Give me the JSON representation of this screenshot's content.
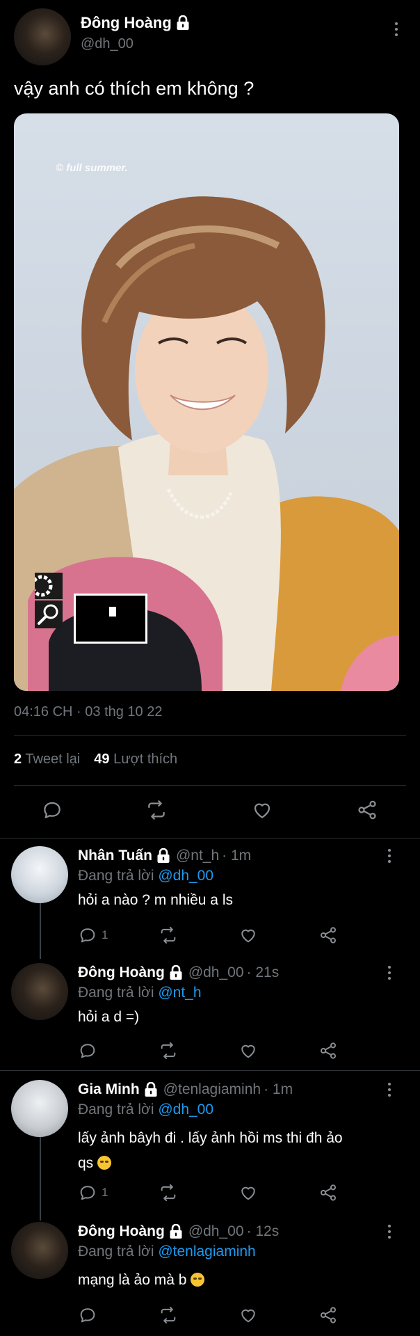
{
  "tweet": {
    "author_name": "Đông Hoàng",
    "author_handle": "@dh_00",
    "text": "vậy anh có thích em không ?",
    "watermark": "© full summer.",
    "timestamp": "04:16 CH · 03 thg 10 22",
    "retweet_count": "2",
    "retweet_label": "Tweet lại",
    "like_count": "49",
    "like_label": "Lượt thích"
  },
  "replies": [
    {
      "name": "Nhân Tuấn",
      "handle": "@nt_h",
      "time": "· 1m",
      "replying_label": "Đang trả lời",
      "replying_to": "@dh_00",
      "text": "hỏi a nào ? m nhiều a ls",
      "reply_count": "1"
    },
    {
      "name": "Đông Hoàng",
      "handle": "@dh_00",
      "time": "· 21s",
      "replying_label": "Đang trả lời",
      "replying_to": "@nt_h",
      "text": "hỏi a d =)"
    },
    {
      "name": "Gia Minh",
      "handle": "@tenlagiaminh",
      "time": "· 1m",
      "replying_label": "Đang trả lời",
      "replying_to": "@dh_00",
      "text_line1": "lấy ảnh bâyh đi . lấy ảnh hồi ms thi đh ảo",
      "text_line2": "qs",
      "reply_count": "1"
    },
    {
      "name": "Đông Hoàng",
      "handle": "@dh_00",
      "time": "· 12s",
      "replying_label": "Đang trả lời",
      "replying_to": "@tenlagiaminh",
      "text": "mạng là ảo mà b"
    }
  ],
  "colors": {
    "background": "#000000",
    "text": "#e7e9ea",
    "muted": "#71767b",
    "link": "#1d9bf0",
    "divider": "#2f3336"
  },
  "icons": [
    "lock-icon",
    "more-icon",
    "reply-icon",
    "retweet-icon",
    "like-icon",
    "share-icon",
    "settings-icon",
    "magnifier-icon",
    "minimap-icon",
    "emoji-icon"
  ]
}
